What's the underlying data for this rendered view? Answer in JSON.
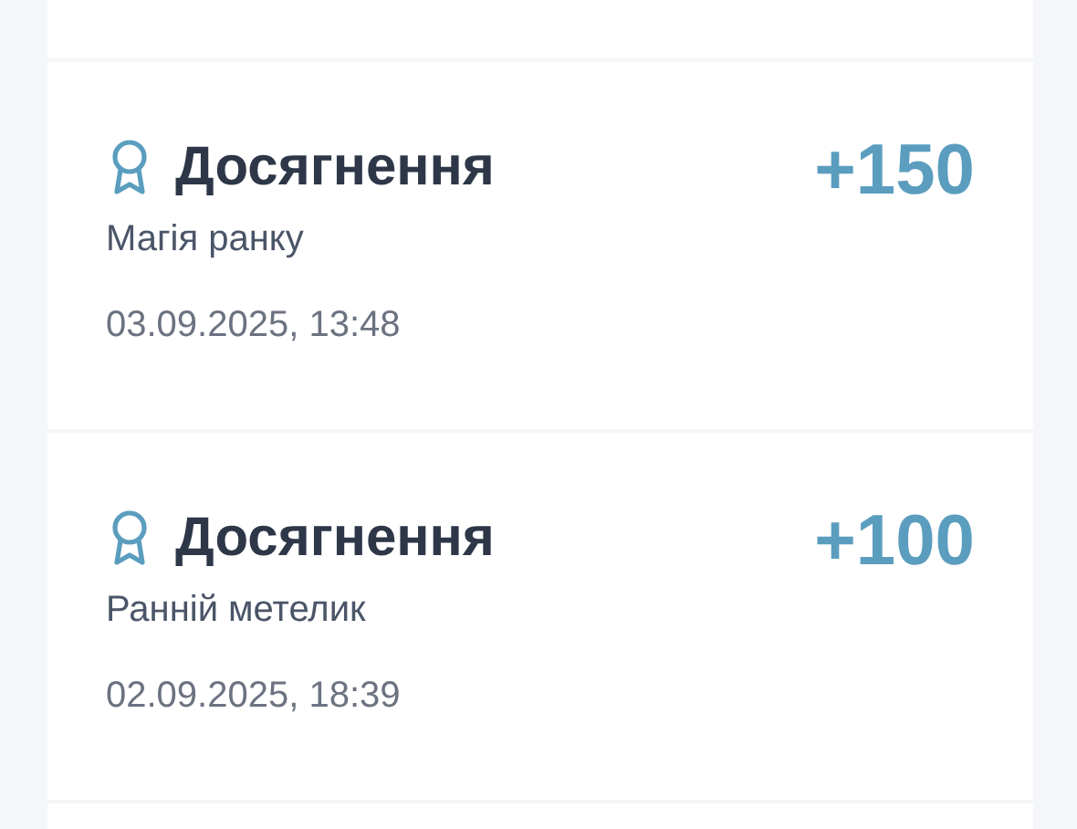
{
  "transactions": [
    {
      "kind": "achievement",
      "title": "Досягнення",
      "points": "+150",
      "description": "Магія ранку",
      "date": "03.09.2025, 13:48"
    },
    {
      "kind": "achievement",
      "title": "Досягнення",
      "points": "+100",
      "description": "Ранній метелик",
      "date": "02.09.2025, 18:39"
    }
  ]
}
